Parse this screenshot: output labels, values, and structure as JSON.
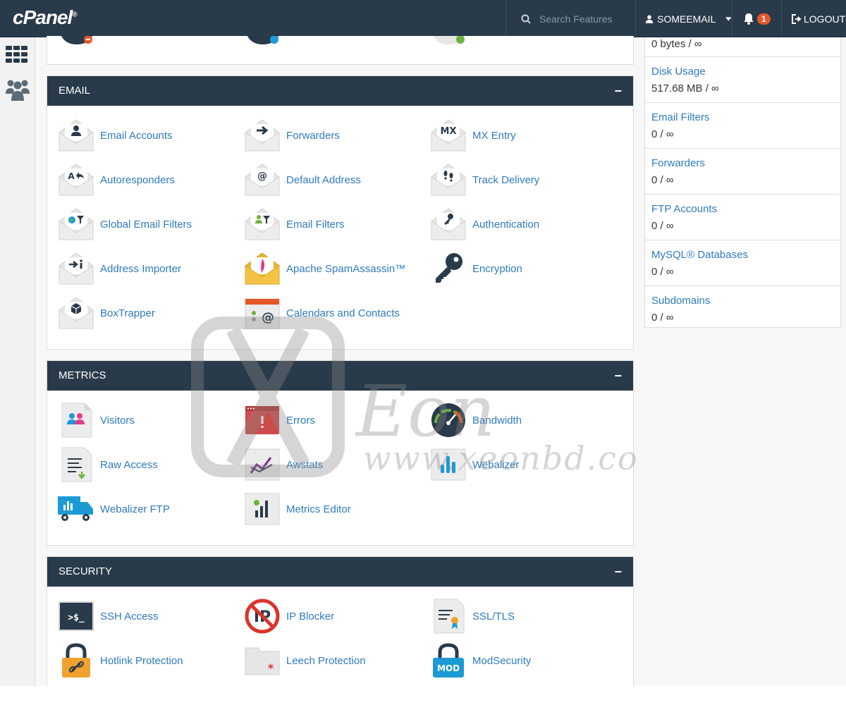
{
  "topbar": {
    "logo": "cPanel",
    "search_placeholder": "Search Features",
    "username": "SOMEEMAIL",
    "notifications": "1",
    "logout": "LOGOUT"
  },
  "colors": {
    "navy": "#293a4a",
    "link": "#2f7bbf",
    "badge": "#e45827"
  },
  "email": {
    "title": "EMAIL",
    "collapse": "−",
    "items": [
      {
        "label": "Email Accounts",
        "icon": "envelope-user-icon"
      },
      {
        "label": "Forwarders",
        "icon": "envelope-arrow-icon"
      },
      {
        "label": "MX Entry",
        "icon": "envelope-mx-icon"
      },
      {
        "label": "Autoresponders",
        "icon": "envelope-reply-icon"
      },
      {
        "label": "Default Address",
        "icon": "envelope-at-icon"
      },
      {
        "label": "Track Delivery",
        "icon": "envelope-footprints-icon"
      },
      {
        "label": "Global Email Filters",
        "icon": "envelope-globe-filter-icon"
      },
      {
        "label": "Email Filters",
        "icon": "envelope-user-filter-icon"
      },
      {
        "label": "Authentication",
        "icon": "envelope-key-icon"
      },
      {
        "label": "Address Importer",
        "icon": "envelope-import-icon"
      },
      {
        "label": "Apache SpamAssassin™",
        "icon": "envelope-feather-icon"
      },
      {
        "label": "Encryption",
        "icon": "key-icon"
      },
      {
        "label": "BoxTrapper",
        "icon": "envelope-box-icon"
      },
      {
        "label": "Calendars and Contacts",
        "icon": "calendar-at-icon"
      }
    ]
  },
  "metrics": {
    "title": "METRICS",
    "collapse": "−",
    "items": [
      {
        "label": "Visitors",
        "icon": "visitors-icon"
      },
      {
        "label": "Errors",
        "icon": "error-window-icon"
      },
      {
        "label": "Bandwidth",
        "icon": "gauge-icon"
      },
      {
        "label": "Raw Access",
        "icon": "raw-log-download-icon"
      },
      {
        "label": "Awstats",
        "icon": "line-chart-icon"
      },
      {
        "label": "Webalizer",
        "icon": "bar-chart-icon"
      },
      {
        "label": "Webalizer FTP",
        "icon": "truck-chart-icon"
      },
      {
        "label": "Metrics Editor",
        "icon": "chart-edit-icon"
      }
    ]
  },
  "security": {
    "title": "SECURITY",
    "collapse": "−",
    "items": [
      {
        "label": "SSH Access",
        "icon": "terminal-icon"
      },
      {
        "label": "IP Blocker",
        "icon": "ip-blocked-icon"
      },
      {
        "label": "SSL/TLS",
        "icon": "certificate-icon"
      },
      {
        "label": "Hotlink Protection",
        "icon": "padlock-link-icon"
      },
      {
        "label": "Leech Protection",
        "icon": "folder-asterisk-icon"
      },
      {
        "label": "ModSecurity",
        "icon": "padlock-mod-icon"
      }
    ]
  },
  "stats": [
    {
      "name": "",
      "value": "0 bytes / ∞"
    },
    {
      "name": "Disk Usage",
      "value": "517.68 MB / ∞"
    },
    {
      "name": "Email Filters",
      "value": "0 / ∞"
    },
    {
      "name": "Forwarders",
      "value": "0 / ∞"
    },
    {
      "name": "FTP Accounts",
      "value": "0 / ∞"
    },
    {
      "name": "MySQL® Databases",
      "value": "0 / ∞"
    },
    {
      "name": "Subdomains",
      "value": "0 / ∞"
    }
  ],
  "watermark": {
    "brand": "Eon",
    "url": "www.xeonbd.com"
  }
}
